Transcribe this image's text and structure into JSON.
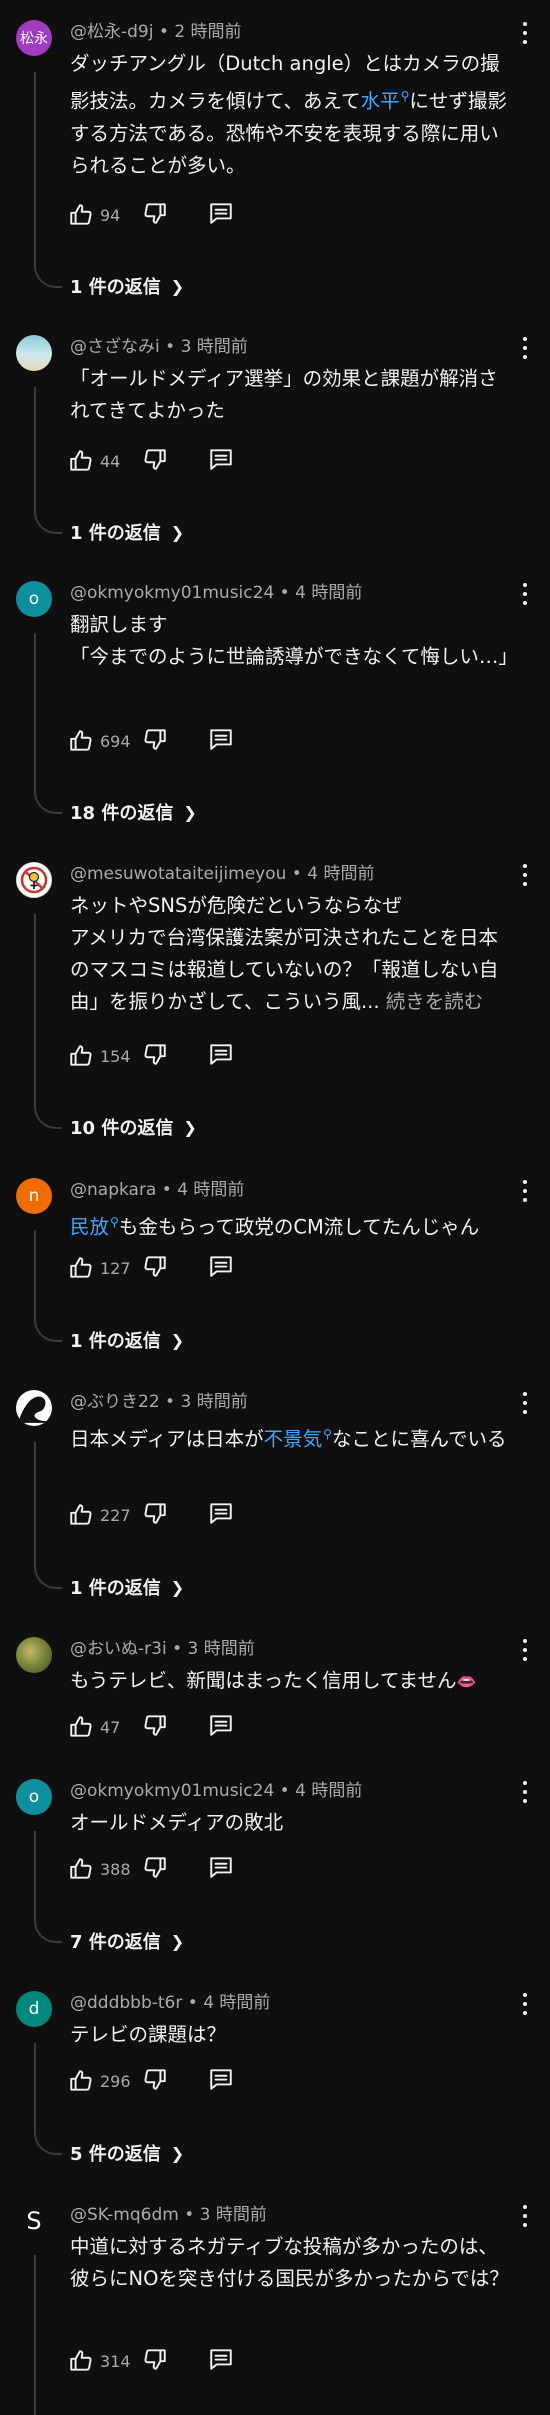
{
  "comments": [
    {
      "avatar_text": "松永",
      "avatar_color": "#a13bc4",
      "handle": "@松永-d9j",
      "time": "2 時間前",
      "text_parts": [
        "ダッチアングル（Dutch angle）とはカメラの撮影技法。カメラを傾けて、あえて",
        "水平",
        "にせず撮影する方法である。恐怖や不安を表現する際に用いられることが多い。"
      ],
      "likes": "94",
      "replies_label": "1 件の返信"
    },
    {
      "avatar_text": "",
      "avatar_color": "#6fb7c9",
      "handle": "@さざなみi",
      "time": "3 時間前",
      "text": "「オールドメディア選挙」の効果と課題が解消されてきてよかった",
      "likes": "44",
      "replies_label": "1 件の返信"
    },
    {
      "avatar_text": "o",
      "avatar_color": "#0e8f9e",
      "handle": "@okmyokmy01music24",
      "time": "4 時間前",
      "text": "翻訳します\n「今までのように世論誘導ができなくて悔しい…」",
      "likes": "694",
      "replies_label": "18 件の返信"
    },
    {
      "avatar_text": "",
      "avatar_color": "#ffffff",
      "handle": "@mesuwotataiteijimeyou",
      "time": "4 時間前",
      "text": "ネットやSNSが危険だというならなぜ\nアメリカで台湾保護法案が可決されたことを日本のマスコミは報道していないの？「報道しない自由」を振りかざして、こういう風...",
      "read_more": "続きを読む",
      "likes": "154",
      "replies_label": "10 件の返信"
    },
    {
      "avatar_text": "n",
      "avatar_color": "#ef6c00",
      "handle": "@napkara",
      "time": "4 時間前",
      "text_parts": [
        "",
        "民放",
        "も金もらって政党のCM流してたんじゃん"
      ],
      "likes": "127",
      "replies_label": "1 件の返信"
    },
    {
      "avatar_text": "",
      "avatar_color": "#ffffff",
      "handle": "@ぶりき22",
      "time": "3 時間前",
      "text_parts": [
        "日本メディアは日本が",
        "不景気",
        "なことに喜んでいる"
      ],
      "likes": "227",
      "replies_label": "1 件の返信"
    },
    {
      "avatar_text": "",
      "avatar_color": "#7a8a3a",
      "handle": "@おいぬ-r3i",
      "time": "3 時間前",
      "text": "もうテレビ、新聞はまったく信用してません",
      "emoji": "👄",
      "likes": "47"
    },
    {
      "avatar_text": "o",
      "avatar_color": "#0e8f9e",
      "handle": "@okmyokmy01music24",
      "time": "4 時間前",
      "text": "オールドメディアの敗北",
      "likes": "388",
      "replies_label": "7 件の返信"
    },
    {
      "avatar_text": "d",
      "avatar_color": "#00897b",
      "handle": "@dddbbb-t6r",
      "time": "4 時間前",
      "text": "テレビの課題は？",
      "likes": "296",
      "replies_label": "5 件の返信"
    },
    {
      "avatar_text": "S",
      "avatar_color": "#0f0f0f",
      "handle": "@SK-mq6dm",
      "time": "3 時間前",
      "text": "中道に対するネガティブな投稿が多かったのは、彼らにNOを突き付ける国民が多かったからでは？",
      "likes": "314"
    }
  ],
  "icons": {
    "like": "thumbs-up-icon",
    "dislike": "thumbs-down-icon",
    "reply": "reply-comment-icon",
    "more": "vertical-dots-icon",
    "chevron": "chevron-right-icon"
  },
  "colors": {
    "background": "#0f0f0f",
    "link": "#3ea6ff",
    "meta": "#aaaaaa"
  }
}
